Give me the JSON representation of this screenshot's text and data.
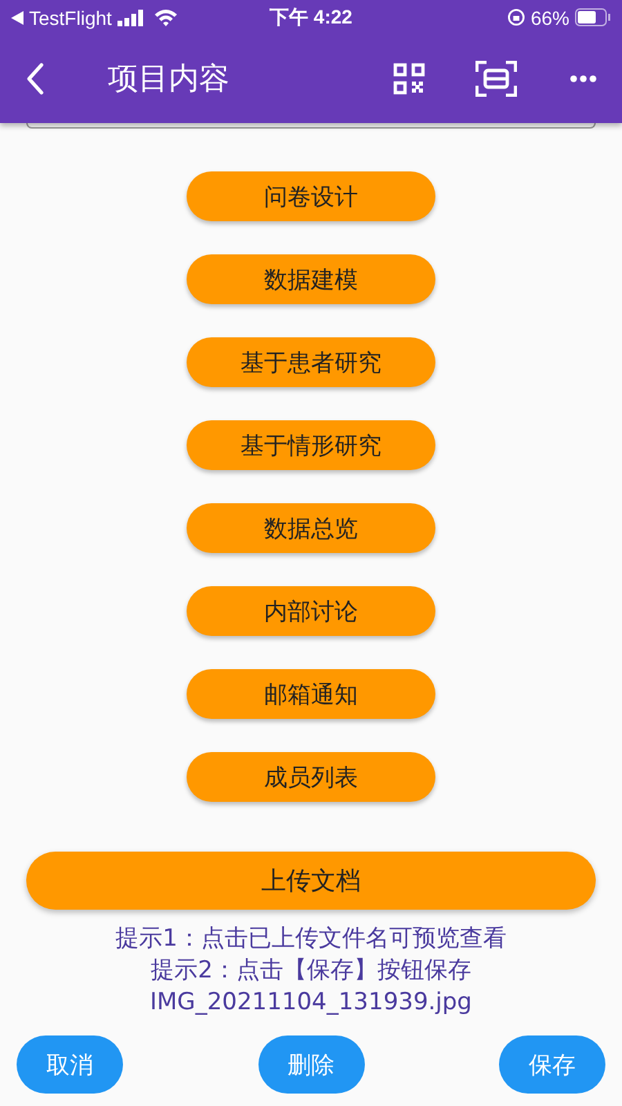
{
  "status_bar": {
    "back_app": "TestFlight",
    "time": "下午 4:22",
    "battery": "66%"
  },
  "app_bar": {
    "title": "项目内容"
  },
  "menu_buttons": [
    {
      "label": "问卷设计"
    },
    {
      "label": "数据建模"
    },
    {
      "label": "基于患者研究"
    },
    {
      "label": "基于情形研究"
    },
    {
      "label": "数据总览"
    },
    {
      "label": "内部讨论"
    },
    {
      "label": "邮箱通知"
    },
    {
      "label": "成员列表"
    }
  ],
  "upload_button": "上传文档",
  "hints": [
    "提示1：点击已上传文件名可预览查看",
    "提示2：点击【保存】按钮保存"
  ],
  "files": [
    "IMG_20211104_131939.jpg"
  ],
  "bottom_buttons": [
    "取消",
    "删除",
    "保存"
  ]
}
